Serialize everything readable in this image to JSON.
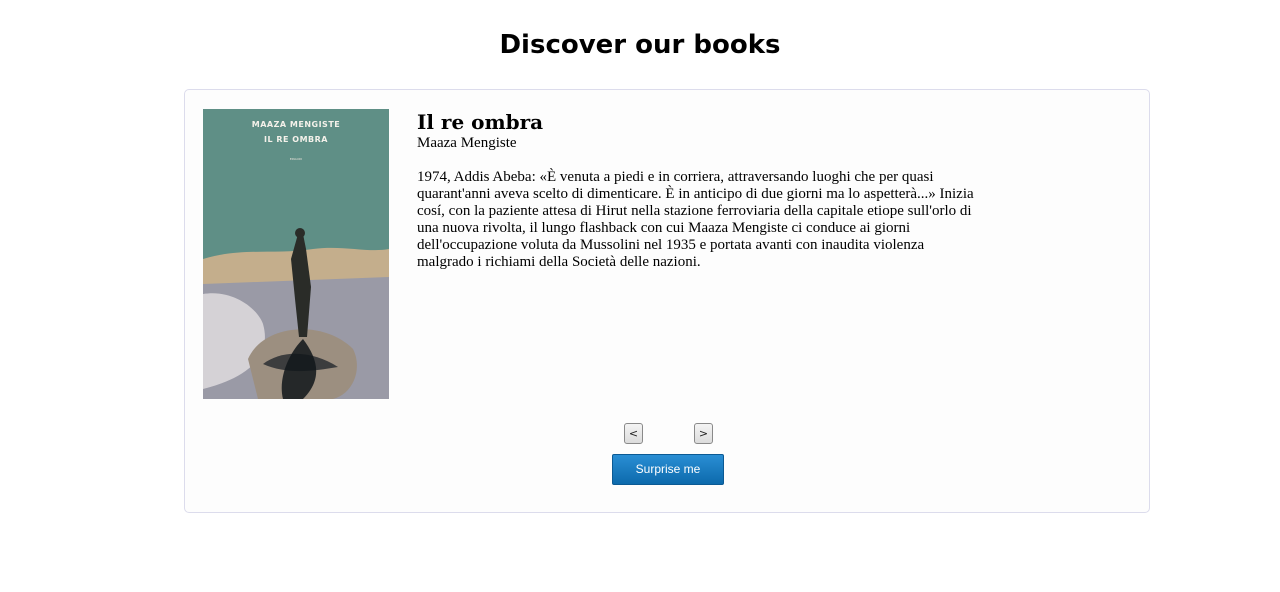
{
  "header": {
    "title": "Discover our books"
  },
  "book": {
    "cover": {
      "author": "MAAZA MENGISTE",
      "title": "IL RE OMBRA",
      "publisher": "EINAUDI"
    },
    "title": "Il re ombra",
    "author": "Maaza Mengiste",
    "description": "1974, Addis Abeba: «È venuta a piedi e in corriera, attraversando luoghi che per quasi quarant'anni aveva scelto di dimenticare. È in anticipo di due giorni ma lo aspetterà...» Inizia cosí, con la paziente attesa di Hirut nella stazione ferroviaria della capitale etiope sull'orlo di una nuova rivolta, il lungo flashback con cui Maaza Mengiste ci conduce ai giorni dell'occupazione voluta da Mussolini nel 1935 e portata avanti con inaudita violenza malgrado i richiami della Società delle nazioni."
  },
  "controls": {
    "prev_label": "<",
    "next_label": ">",
    "surprise_label": "Surprise me"
  },
  "colors": {
    "primary_button": "#1a7cc1",
    "card_border": "#dcdcec"
  }
}
